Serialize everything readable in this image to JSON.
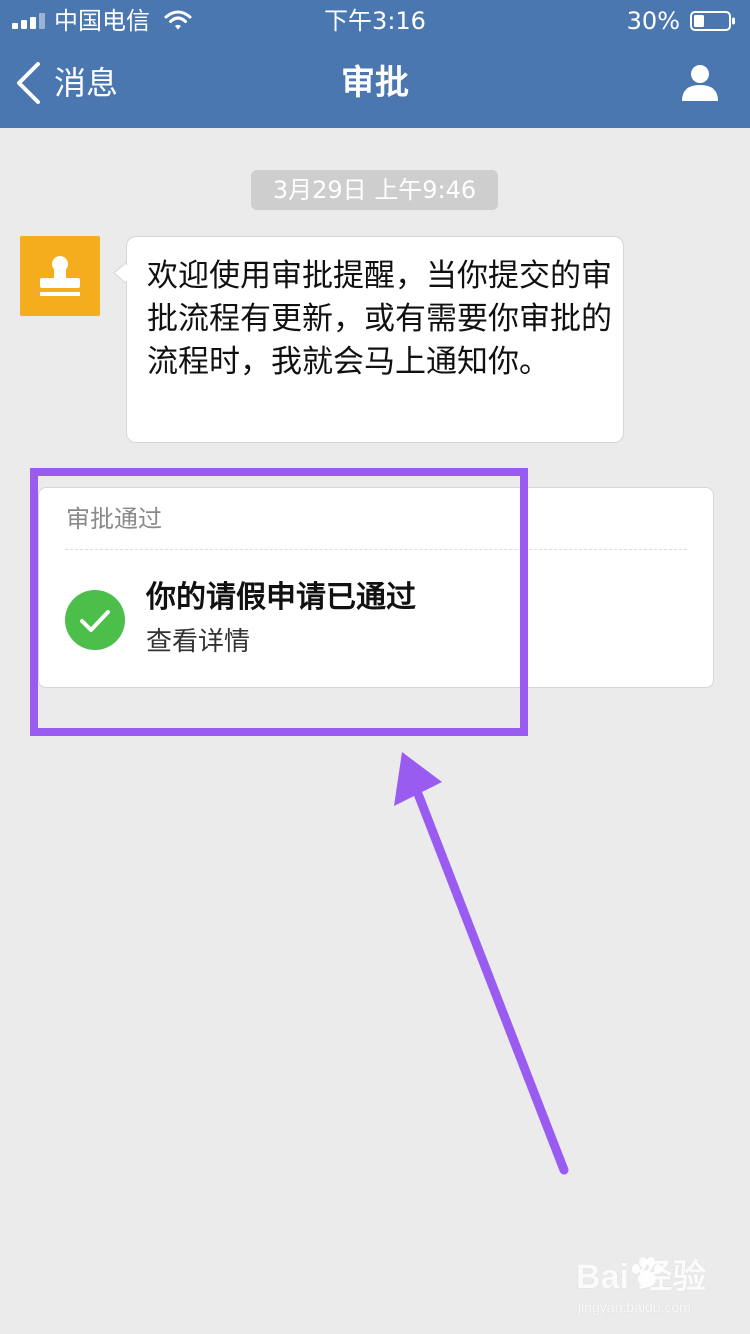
{
  "status_bar": {
    "carrier": "中国电信",
    "time": "下午3:16",
    "battery": "30%"
  },
  "nav": {
    "back_label": "消息",
    "title": "审批",
    "back_icon": "chevron-left-icon",
    "profile_icon": "user-icon"
  },
  "chat": {
    "timestamp": "3月29日 上午9:46",
    "avatar_icon": "stamp-icon",
    "welcome_message": "欢迎使用审批提醒，当你提交的审批流程有更新，或有需要你审批的流程时，我就会马上通知你。"
  },
  "card": {
    "header": "审批通过",
    "title": "你的请假申请已通过",
    "link": "查看详情",
    "status_icon": "check-circle-icon"
  },
  "watermark": {
    "brand": "Bai  经验",
    "url": "jingyan.baidu.com"
  },
  "colors": {
    "header_bg": "#4a77b0",
    "page_bg": "#ebebeb",
    "avatar_bg": "#f4ae1d",
    "check_green": "#4bbf4a",
    "annotation_purple": "#9a5cf0"
  }
}
